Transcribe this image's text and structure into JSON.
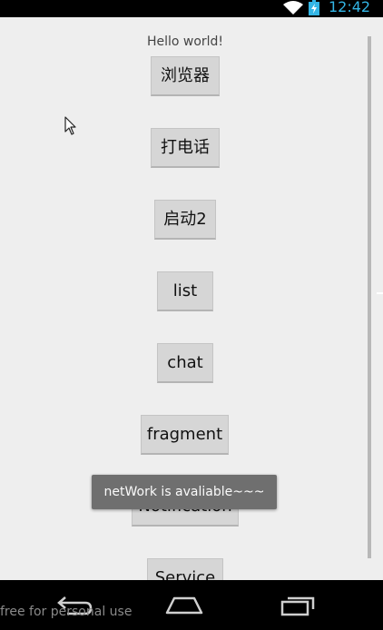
{
  "status_bar": {
    "time": "12:42",
    "icons": [
      "wifi-icon",
      "battery-charging-icon"
    ],
    "time_color": "#33b5e5"
  },
  "main": {
    "hello_text": "Hello world!",
    "buttons": [
      {
        "label": "浏览器"
      },
      {
        "label": "打电话"
      },
      {
        "label": "启动2"
      },
      {
        "label": "list"
      },
      {
        "label": "chat"
      },
      {
        "label": "fragment"
      },
      {
        "label": "Notification"
      },
      {
        "label": "Service"
      }
    ],
    "background": "#eeeeee",
    "button_color": "#d6d6d6"
  },
  "toast": {
    "text": "netWork is avaliable~~~"
  },
  "nav_bar": {
    "icons": [
      "back-icon",
      "home-icon",
      "recent-apps-icon"
    ],
    "watermark": "free for personal use"
  }
}
